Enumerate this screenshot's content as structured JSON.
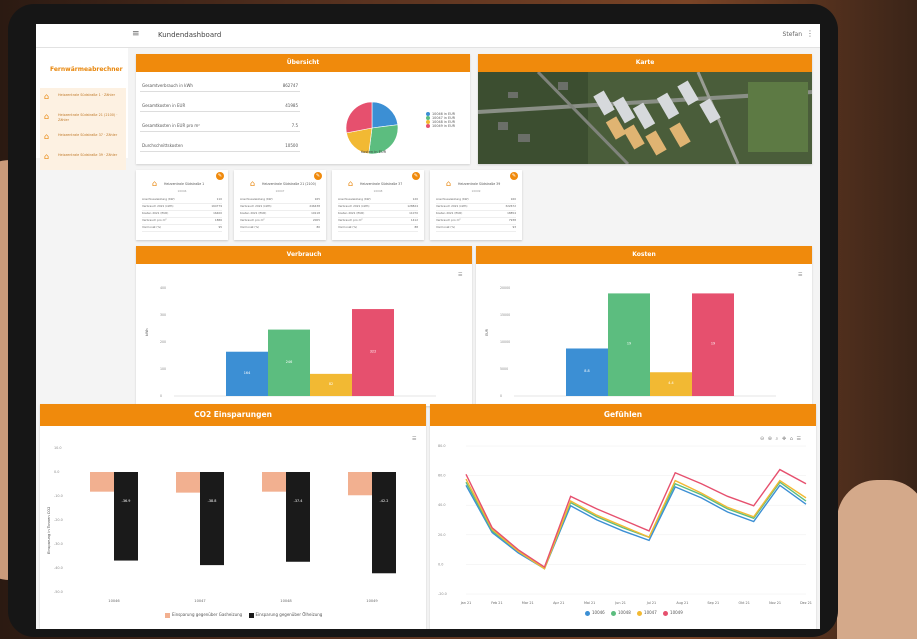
{
  "app": {
    "title": "Kundendashboard",
    "user_menu": "Stefan"
  },
  "sidebar": {
    "logo": "Fernwärmeabrechner",
    "items": [
      {
        "label": "Heizzentrale Südstraße 1 · Zähler"
      },
      {
        "label": "Heizzentrale Südstraße 21 (2100) · Zähler"
      },
      {
        "label": "Heizzentrale Südstraße 37 · Zähler"
      },
      {
        "label": "Heizzentrale Südstraße 39 · Zähler"
      }
    ]
  },
  "overview": {
    "title": "Übersicht",
    "rows": [
      {
        "label": "Gesamtverbrauch in kWh",
        "value": "862747"
      },
      {
        "label": "Gesamtkosten in EUR",
        "value": "41985"
      },
      {
        "label": "Gesamtkosten in EUR pro m²",
        "value": "7.5"
      },
      {
        "label": "Durchschnittskosten",
        "value": "10500"
      }
    ],
    "pie_caption": "Kosten in EUR",
    "pie_slices": [
      {
        "name": "10046 in EUR",
        "value": 0.23,
        "color": "#3c8fd4"
      },
      {
        "name": "10047 in EUR",
        "value": 0.29,
        "color": "#5cbd7f"
      },
      {
        "name": "10048 in EUR",
        "value": 0.2,
        "color": "#f2b933"
      },
      {
        "name": "10049 in EUR",
        "value": 0.28,
        "color": "#e6506e"
      }
    ]
  },
  "map_card": {
    "title": "Karte"
  },
  "meters": [
    {
      "name": "Heizzentrale Südstraße 1",
      "sub": "10046",
      "rows": [
        [
          "Anschlussleistung (KW)",
          "110"
        ],
        [
          "Verbrauch 2021 (kWh)",
          "164779"
        ],
        [
          "Kosten 2021 (EUR)",
          "16400"
        ],
        [
          "Verbrauch pro m²",
          "1886"
        ],
        [
          "Vormonat (%)",
          "95"
        ]
      ]
    },
    {
      "name": "Heizzentrale Südstraße 21 (2100)",
      "sub": "10047",
      "rows": [
        [
          "Anschlussleistung (KW)",
          "165"
        ],
        [
          "Verbrauch 2021 (kWh)",
          "246438"
        ],
        [
          "Kosten 2021 (EUR)",
          "19118"
        ],
        [
          "Verbrauch pro m²",
          "2005"
        ],
        [
          "Vormonat (%)",
          "80"
        ]
      ]
    },
    {
      "name": "Heizzentrale Südstraße 37",
      "sub": "10048",
      "rows": [
        [
          "Anschlussleistung (KW)",
          "120"
        ],
        [
          "Verbrauch 2021 (kWh)",
          "128824"
        ],
        [
          "Kosten 2021 (EUR)",
          "11070"
        ],
        [
          "Verbrauch pro m²",
          "1412"
        ],
        [
          "Vormonat (%)",
          "88"
        ]
      ]
    },
    {
      "name": "Heizzentrale Südstraße 39",
      "sub": "10049",
      "rows": [
        [
          "Anschlussleistung (KW)",
          "160"
        ],
        [
          "Verbrauch 2021 (kWh)",
          "322672"
        ],
        [
          "Kosten 2021 (EUR)",
          "18854"
        ],
        [
          "Verbrauch pro m²",
          "7938"
        ],
        [
          "Vormonat (%)",
          "93"
        ]
      ]
    }
  ],
  "charts": {
    "verbrauch": {
      "title": "Verbrauch"
    },
    "kosten": {
      "title": "Kosten"
    },
    "co2": {
      "title": "CO2 Einsparungen"
    },
    "gefuehlt": {
      "title": "Gefühlen"
    }
  },
  "chart_data": [
    {
      "type": "bar",
      "title": "Verbrauch",
      "ylabel": "kWh",
      "ylim": [
        0,
        400
      ],
      "yticks": [
        "400",
        "300",
        "200",
        "100",
        "0"
      ],
      "series": [
        {
          "name": "10046",
          "values": [
            164
          ],
          "color": "#3c8fd4",
          "label": "164"
        },
        {
          "name": "10047",
          "values": [
            246
          ],
          "color": "#5cbd7f",
          "label": "246"
        },
        {
          "name": "10048",
          "values": [
            82
          ],
          "color": "#f2b933",
          "label": "82"
        },
        {
          "name": "10049",
          "values": [
            322
          ],
          "color": "#e6506e",
          "label": "322"
        }
      ]
    },
    {
      "type": "bar",
      "title": "Kosten",
      "ylabel": "EUR",
      "ylim": [
        0,
        20000
      ],
      "yticks": [
        "20000",
        "15000",
        "10000",
        "5000",
        "0"
      ],
      "series": [
        {
          "name": "10046",
          "values": [
            8800
          ],
          "color": "#3c8fd4",
          "label": "8.8"
        },
        {
          "name": "10047",
          "values": [
            19000
          ],
          "color": "#5cbd7f",
          "label": "19"
        },
        {
          "name": "10048",
          "values": [
            4400
          ],
          "color": "#f2b933",
          "label": "4.4"
        },
        {
          "name": "10049",
          "values": [
            19000
          ],
          "color": "#e6506e",
          "label": "19"
        }
      ]
    },
    {
      "type": "bar",
      "title": "CO2 Einsparungen",
      "ylabel": "Einsparung in Tonnen CO2",
      "categories": [
        "10046",
        "10047",
        "10048",
        "10049"
      ],
      "ylim": [
        -50,
        10
      ],
      "yticks": [
        "10.0",
        "0.0",
        "-10.0",
        "-20.0",
        "-30.0",
        "-40.0",
        "-50.0"
      ],
      "series": [
        {
          "name": "Einsparung gegenüber Gasheizung",
          "color": "#f2b090",
          "values": [
            -8.2,
            -8.6,
            -8.2,
            -9.7
          ]
        },
        {
          "name": "Einsparung gegenüber Ölheizung",
          "color": "#1a1a1a",
          "values": [
            -36.9,
            -38.8,
            -37.4,
            -42.2
          ]
        }
      ],
      "legend": "bottom"
    },
    {
      "type": "line",
      "title": "Gefühlen",
      "x": [
        "Jan 21",
        "Feb 21",
        "Mar 21",
        "Apr 21",
        "Mai 21",
        "Jun 21",
        "Jul 21",
        "Aug 21",
        "Sep 21",
        "Okt 21",
        "Nov 21",
        "Dez 21"
      ],
      "ylim": [
        0,
        80
      ],
      "yticks": [
        "80.0",
        "60.0",
        "40.0",
        "20.0",
        "0.0",
        "-20.0"
      ],
      "series": [
        {
          "name": "10046",
          "color": "#3c8fd4",
          "values": [
            55,
            25,
            12,
            2,
            42,
            33,
            26,
            20,
            54,
            47,
            38,
            32,
            55,
            43
          ]
        },
        {
          "name": "10048",
          "color": "#5cbd7f",
          "values": [
            57,
            26,
            13,
            2,
            44,
            35,
            28,
            22,
            56,
            49,
            40,
            34,
            57,
            45
          ]
        },
        {
          "name": "10047",
          "color": "#f2b933",
          "values": [
            59,
            27,
            13,
            2,
            45,
            36,
            29,
            22,
            58,
            50,
            41,
            35,
            58,
            47
          ]
        },
        {
          "name": "10049",
          "color": "#e6506e",
          "values": [
            62,
            28,
            14,
            3,
            48,
            40,
            33,
            26,
            63,
            56,
            48,
            42,
            65,
            56
          ]
        }
      ],
      "legend": "bottom"
    }
  ]
}
